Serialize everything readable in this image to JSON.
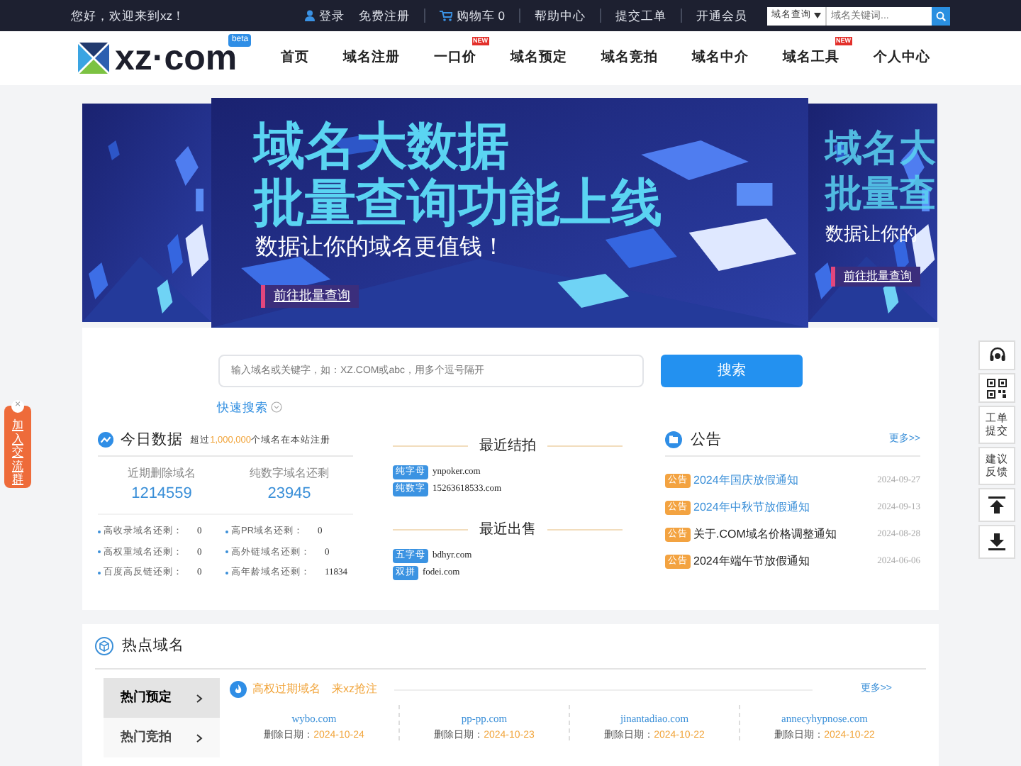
{
  "top_bar": {
    "greeting": "您好，欢迎来到xz！",
    "links": [
      {
        "label": "登录",
        "kind": "account"
      },
      {
        "label": "免费注册",
        "kind": "plain"
      },
      {
        "label": "购物车 0",
        "kind": "cart"
      },
      {
        "label": "帮助中心",
        "kind": "plain"
      },
      {
        "label": "提交工单",
        "kind": "plain"
      },
      {
        "label": "开通会员",
        "kind": "plain"
      }
    ],
    "search": {
      "scope": "域名查询",
      "placeholder": "域名关键词..."
    }
  },
  "header": {
    "logo": "xz·com",
    "logo_badge": "beta",
    "nav": [
      {
        "label": "首页"
      },
      {
        "label": "域名注册"
      },
      {
        "label": "一口价",
        "badge": "NEW"
      },
      {
        "label": "域名预定"
      },
      {
        "label": "域名竞拍"
      },
      {
        "label": "域名中介"
      },
      {
        "label": "域名工具",
        "badge": "NEW"
      },
      {
        "label": "个人中心"
      }
    ]
  },
  "banner": {
    "title_lines": [
      "域名大数据",
      "批量查询功能上线"
    ],
    "subtitle": "数据让你的域名更值钱！",
    "button": "前往批量查询",
    "side": {
      "title_lines": [
        "域名大",
        "批量查"
      ],
      "subtitle": "数据让你的",
      "button": "前往批量查询"
    }
  },
  "search": {
    "placeholder": "输入域名或关键字，如：XZ.COM或abc，用多个逗号隔开",
    "button": "搜索",
    "quick": "快速搜索"
  },
  "today": {
    "title": "今日数据",
    "note_before": "超过",
    "note_number": "1,000,000",
    "note_after": "个域名在本站注册",
    "stats": [
      {
        "label": "近期删除域名",
        "value": "1214559"
      },
      {
        "label": "纯数字域名还剩",
        "value": "23945"
      }
    ],
    "items": [
      {
        "label": "高收录域名还剩：",
        "value": "0"
      },
      {
        "label": "高PR域名还剩：",
        "value": "0"
      },
      {
        "label": "高权重域名还剩：",
        "value": "0"
      },
      {
        "label": "高外链域名还剩：",
        "value": "0"
      },
      {
        "label": "百度高反链还剩：",
        "value": "0"
      },
      {
        "label": "高年龄域名还剩：",
        "value": "11834"
      }
    ]
  },
  "recent_auctions": {
    "title": "最近结拍",
    "items": [
      {
        "tag": "纯字母",
        "domain": "ynpoker.com"
      },
      {
        "tag": "纯数字",
        "domain": "15263618533.com"
      }
    ]
  },
  "recent_sales": {
    "title": "最近出售",
    "items": [
      {
        "tag": "五字母",
        "domain": "bdhyr.com"
      },
      {
        "tag": "双拼",
        "domain": "fodei.com"
      }
    ]
  },
  "notices": {
    "title": "公告",
    "more": "更多>>",
    "items": [
      {
        "tag": "公告",
        "text": "2024年国庆放假通知",
        "date": "2024-09-27",
        "highlighted": true
      },
      {
        "tag": "公告",
        "text": "2024年中秋节放假通知",
        "date": "2024-09-13",
        "highlighted": true
      },
      {
        "tag": "公告",
        "text": "关于.COM域名价格调整通知",
        "date": "2024-08-28",
        "highlighted": false
      },
      {
        "tag": "公告",
        "text": "2024年端午节放假通知",
        "date": "2024-06-06",
        "highlighted": false
      }
    ]
  },
  "hot": {
    "title": "热点域名",
    "tabs": [
      {
        "label": "热门预定",
        "selected": true
      },
      {
        "label": "热门竞拍",
        "selected": false
      }
    ],
    "subtitle": "高权过期域名",
    "subtitle_extra": "来xz抢注",
    "more": "更多>>",
    "domains": [
      {
        "name": "wybo.com",
        "date_label": "删除日期：",
        "date": "2024-10-24"
      },
      {
        "name": "pp-pp.com",
        "date_label": "删除日期：",
        "date": "2024-10-23"
      },
      {
        "name": "jinantadiao.com",
        "date_label": "删除日期：",
        "date": "2024-10-22"
      },
      {
        "name": "annecyhypnose.com",
        "date_label": "删除日期：",
        "date": "2024-10-22"
      }
    ]
  },
  "side_tools": [
    {
      "kind": "headset"
    },
    {
      "kind": "qrcode"
    },
    {
      "kind": "text",
      "label": "工单提交"
    },
    {
      "kind": "text",
      "label": "建议反馈"
    },
    {
      "kind": "top"
    },
    {
      "kind": "bottom"
    }
  ],
  "float_tag": {
    "label": "加入交流群",
    "close": "×"
  }
}
